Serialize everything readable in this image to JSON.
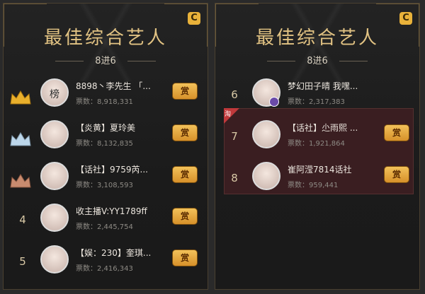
{
  "panels": [
    {
      "title": "最佳综合艺人",
      "subtitle": "8进6",
      "rows": [
        {
          "rank": "",
          "crown": "gold",
          "avatar_text": "榜",
          "name": "8898丶李先生 「...",
          "votes": "票数：8,918,331",
          "reward": "赏"
        },
        {
          "rank": "",
          "crown": "silver",
          "avatar_text": "",
          "name": "【炎黄】夏玲美",
          "votes": "票数：8,132,835",
          "reward": "赏"
        },
        {
          "rank": "",
          "crown": "bronze",
          "avatar_text": "",
          "name": "【话社】9759芮...",
          "votes": "票数：3,108,593",
          "reward": "赏"
        },
        {
          "rank": "4",
          "crown": "",
          "avatar_text": "",
          "name": "收主播V:YY1789ff",
          "votes": "票数：2,445,754",
          "reward": "赏"
        },
        {
          "rank": "5",
          "crown": "",
          "avatar_text": "",
          "name": "【娱：230】奎琪...",
          "votes": "票数：2,416,343",
          "reward": "赏"
        }
      ]
    },
    {
      "title": "最佳综合艺人",
      "subtitle": "8进6",
      "flag_text": "淘",
      "rows": [
        {
          "rank": "6",
          "avatar_text": "",
          "name": "梦幻田子晴 我嘿...",
          "votes": "票数：2,317,383",
          "reward": "",
          "badge": "purple"
        },
        {
          "rank": "7",
          "avatar_text": "",
          "name": "【话社】尐雨熙 ...",
          "votes": "票数：1,921,864",
          "reward": "赏"
        },
        {
          "rank": "8",
          "avatar_text": "",
          "name": "崔阿滢7814话社",
          "votes": "票数：959,441",
          "reward": "赏"
        }
      ]
    }
  ],
  "colors": {
    "gold": "#e2c383",
    "reward": "#f2c15a",
    "highlight": "#3a1e21",
    "flag": "#c0393b"
  },
  "icons": {
    "refresh": "refresh-icon",
    "crown": "crown-icon"
  }
}
